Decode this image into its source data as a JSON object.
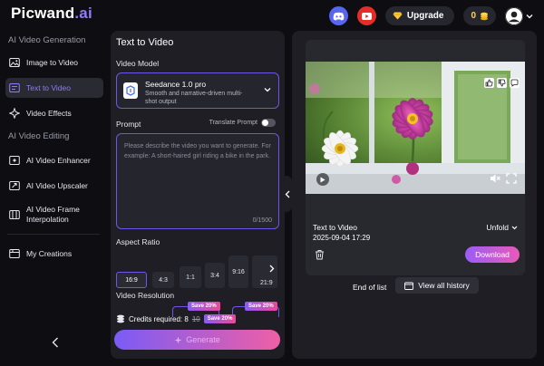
{
  "app": {
    "logo_main": "Picwand",
    "logo_ai": ".ai"
  },
  "header": {
    "upgrade_label": "Upgrade",
    "credits": "0"
  },
  "sidebar": {
    "sections": [
      {
        "title": "AI Video Generation",
        "items": [
          {
            "label": "Image to Video",
            "icon": "image-icon"
          },
          {
            "label": "Text to Video",
            "icon": "text-video-icon",
            "active": true
          },
          {
            "label": "Video Effects",
            "icon": "sparkle-icon"
          }
        ]
      },
      {
        "title": "AI Video Editing",
        "items": [
          {
            "label": "AI Video Enhancer",
            "icon": "enhance-icon"
          },
          {
            "label": "AI Video Upscaler",
            "icon": "upscale-icon"
          },
          {
            "label": "AI Video Frame Interpolation",
            "icon": "frame-icon"
          }
        ]
      }
    ],
    "my_creations": "My Creations"
  },
  "form": {
    "title": "Text to Video",
    "video_model_label": "Video Model",
    "model": {
      "name": "Seedance 1.0 pro",
      "description": "Smooth and narrative-driven multi-shot output"
    },
    "prompt_label": "Prompt",
    "translate_label": "Translate Prompt",
    "prompt_placeholder": "Please describe the video you want to generate. For example: A short-haired girl riding a bike in the park.",
    "prompt_value": "",
    "char_count": "0/1500",
    "aspect_label": "Aspect Ratio",
    "aspect_ratios": [
      "16:9",
      "4:3",
      "1:1",
      "3:4",
      "9:16",
      "21:9"
    ],
    "selected_ratio": "16:9",
    "resolution_label": "Video Resolution",
    "save_badge": "Save 20%",
    "credits_label": "Credits required: 8",
    "credits_old": "10",
    "generate_label": "Generate"
  },
  "result": {
    "title": "Text to Video",
    "date": "2025-09-04 17:29",
    "unfold_label": "Unfold",
    "download_label": "Download",
    "end_of_list": "End of list",
    "view_history": "View all history"
  },
  "colors": {
    "accent": "#6c57e8",
    "background": "#0d0d12",
    "panel": "#1e1e24",
    "gradient_start": "#7a5cf6",
    "gradient_end": "#ef5fa5"
  }
}
